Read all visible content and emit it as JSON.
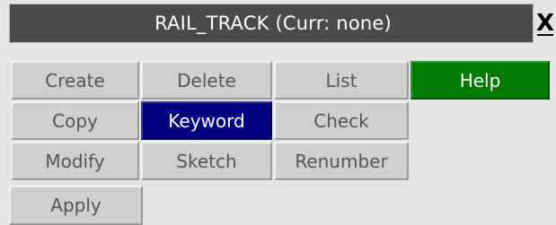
{
  "panel": {
    "title": "RAIL_TRACK (Curr: none)",
    "close_label": "X"
  },
  "buttons": {
    "create": "Create",
    "delete": "Delete",
    "list": "List",
    "help": "Help",
    "copy": "Copy",
    "keyword": "Keyword",
    "check": "Check",
    "modify": "Modify",
    "sketch": "Sketch",
    "renumber": "Renumber",
    "apply": "Apply"
  },
  "colors": {
    "title_bg": "#4a4a4a",
    "active_button": "#000080",
    "help_button": "#007a00",
    "button_bg": "#cfcfcf"
  }
}
